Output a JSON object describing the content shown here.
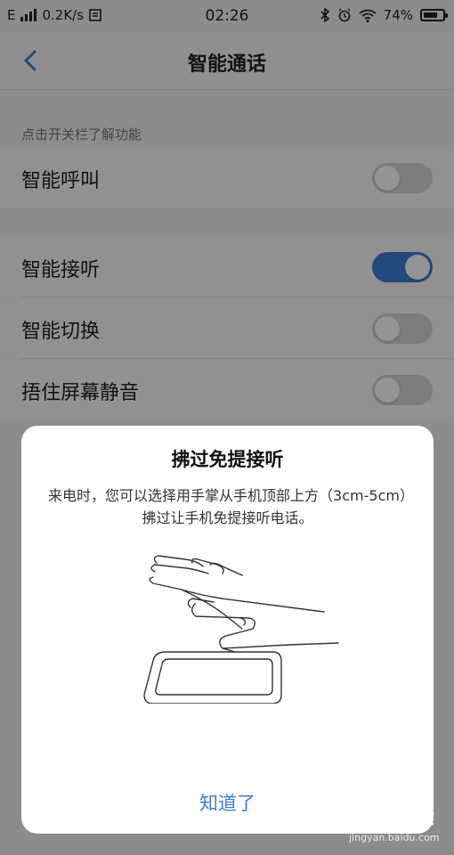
{
  "status_bar": {
    "network_type": "E",
    "speed": "0.2K/s",
    "time": "02:26",
    "battery_percent": "74%",
    "battery_level": 0.74
  },
  "nav": {
    "title": "智能通话"
  },
  "section_hint": "点击开关栏了解功能",
  "settings": {
    "smart_call": {
      "label": "智能呼叫",
      "enabled": false
    },
    "smart_answer": {
      "label": "智能接听",
      "enabled": true
    },
    "smart_switch": {
      "label": "智能切换",
      "enabled": false
    },
    "cover_mute": {
      "label": "捂住屏幕静音",
      "enabled": false
    }
  },
  "dialog": {
    "title": "拂过免提接听",
    "text": "来电时，您可以选择用手掌从手机顶部上方（3cm-5cm）拂过让手机免提接听电话。",
    "confirm_label": "知道了"
  },
  "watermark": {
    "logo": "Bai 经验",
    "url": "jingyan.baidu.com"
  },
  "colors": {
    "accent": "#3d7ed8",
    "overlay": "rgba(0,0,0,0.42)"
  }
}
